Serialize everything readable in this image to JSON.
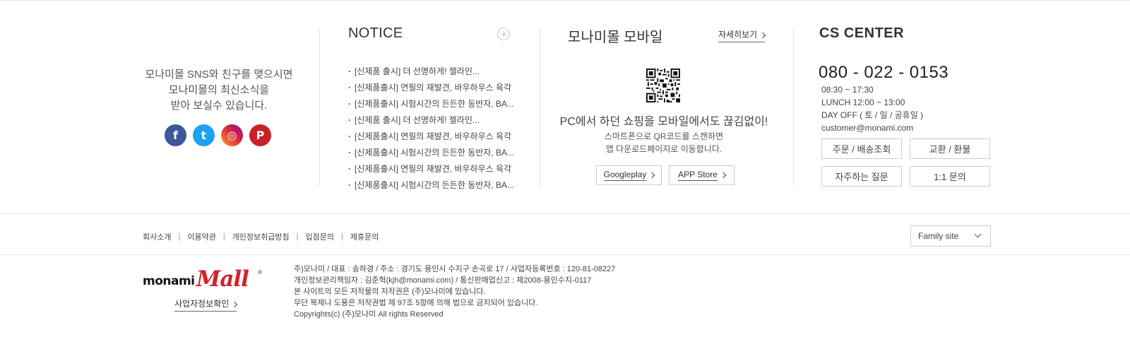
{
  "sns": {
    "text_lines": [
      "모나미몰 SNS와 친구를 맺으시면",
      "모나미몰의 최신소식을",
      "받아 보실수 있습니다."
    ],
    "icons": [
      {
        "name": "facebook-icon",
        "glyph": "f",
        "color": "#3b5998"
      },
      {
        "name": "twitter-icon",
        "glyph": "t",
        "color": "#1da1f2"
      },
      {
        "name": "instagram-icon",
        "glyph": "◎",
        "color": "#e53935"
      },
      {
        "name": "pinterest-icon",
        "glyph": "P",
        "color": "#cb2027"
      }
    ]
  },
  "notice": {
    "title": "NOTICE",
    "items": [
      "[신제품 출시] 더 선명하게! 젤라인...",
      "[신제품출시] 연필의 재발견, 바우하우스 육각",
      "[신제품출시] 시험시간의 든든한 동반자, BA...",
      "[신제품 출시] 더 선명하게! 젤라인...",
      "[신제품출시] 연필의 재발견, 바우하우스 육각",
      "[신제품출시] 시험시간의 든든한 동반자, BA...",
      "[신제품출시] 연필의 재발견, 바우하우스 육각",
      "[신제품출시] 시험시간의 든든한 동반자, BA..."
    ]
  },
  "mobile": {
    "title": "모나미몰 모바일",
    "more_label": "자세히보기",
    "headline": "PC에서 하던 쇼핑을 모바일에서도 끊김없이!",
    "sub_lines": [
      "스마트폰으로 QR코드를 스캔하면",
      "앱 다운로드페이지로 이동합니다."
    ],
    "googleplay_label": "Googleplay",
    "appstore_label": "APP Store"
  },
  "cs": {
    "title": "CS CENTER",
    "phone": "080 - 022 - 0153",
    "hours": "08:30 ~ 17:30",
    "lunch": "LUNCH 12:00 ~ 13:00",
    "dayoff": "DAY OFF ( 토 / 일 / 공휴일 )",
    "email": "customer@monami.com",
    "buttons": [
      "주문 / 배송조회",
      "교환 / 환불",
      "자주하는 질문",
      "1:1 문의"
    ]
  },
  "footer_nav": [
    "회사소개",
    "이용약관",
    "개인정보취급방침",
    "입점문의",
    "제휴문의"
  ],
  "family_site": "Family site",
  "logo": {
    "monami": "monami",
    "mall": "Mall",
    "reg": "®"
  },
  "biz_check": "사업자정보확인",
  "company_lines": [
    "주)모나미 / 대표 : 송하경 / 주소 : 경기도 용인시 수지구 손곡로 17 / 사업자등록번호 : 120-81-08227",
    "개인정보관리책임자 : 김준혁(kjh@monami.com) / 통신판매업신고 : 제2008-용인수지-0117",
    "본 사이트의 모든 저작물의 저작권은 (주)모나미에 있습니다.",
    "무단 복제나 도용은 저작권법 제 97조 5항에 의해 법으로 금지되어 있습니다.",
    "Copyrights(c) (주)모나미 All rights Reserved"
  ]
}
